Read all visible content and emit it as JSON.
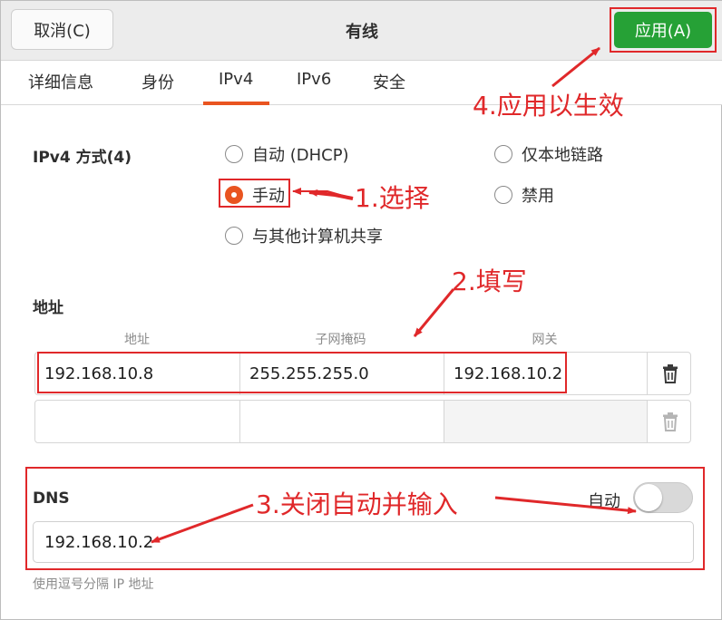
{
  "header": {
    "cancel_label": "取消(C)",
    "title": "有线",
    "apply_label": "应用(A)"
  },
  "tabs": [
    {
      "label": "详细信息"
    },
    {
      "label": "身份"
    },
    {
      "label": "IPv4",
      "active": true
    },
    {
      "label": "IPv6"
    },
    {
      "label": "安全"
    }
  ],
  "ipv4": {
    "method_label": "IPv4 方式(4)",
    "options": {
      "auto_dhcp": "自动 (DHCP)",
      "link_local": "仅本地链路",
      "manual": "手动",
      "disabled": "禁用",
      "shared": "与其他计算机共享"
    },
    "selected": "手动"
  },
  "addresses": {
    "section_label": "地址",
    "columns": [
      "地址",
      "子网掩码",
      "网关"
    ],
    "rows": [
      {
        "address": "192.168.10.8",
        "netmask": "255.255.255.0",
        "gateway": "192.168.10.2"
      },
      {
        "address": "",
        "netmask": "",
        "gateway": ""
      }
    ]
  },
  "dns": {
    "label": "DNS",
    "auto_label": "自动",
    "auto_enabled": false,
    "value": "192.168.10.2",
    "hint": "使用逗号分隔 IP 地址"
  },
  "annotations": {
    "step1": "1.选择",
    "step2": "2.填写",
    "step3": "3.关闭自动并输入",
    "step4": "4.应用以生效"
  },
  "colors": {
    "accent": "#e95420",
    "apply_green": "#26a136",
    "annotation_red": "#e0282a"
  },
  "icons": [
    "trash-icon",
    "arrow-icon"
  ]
}
